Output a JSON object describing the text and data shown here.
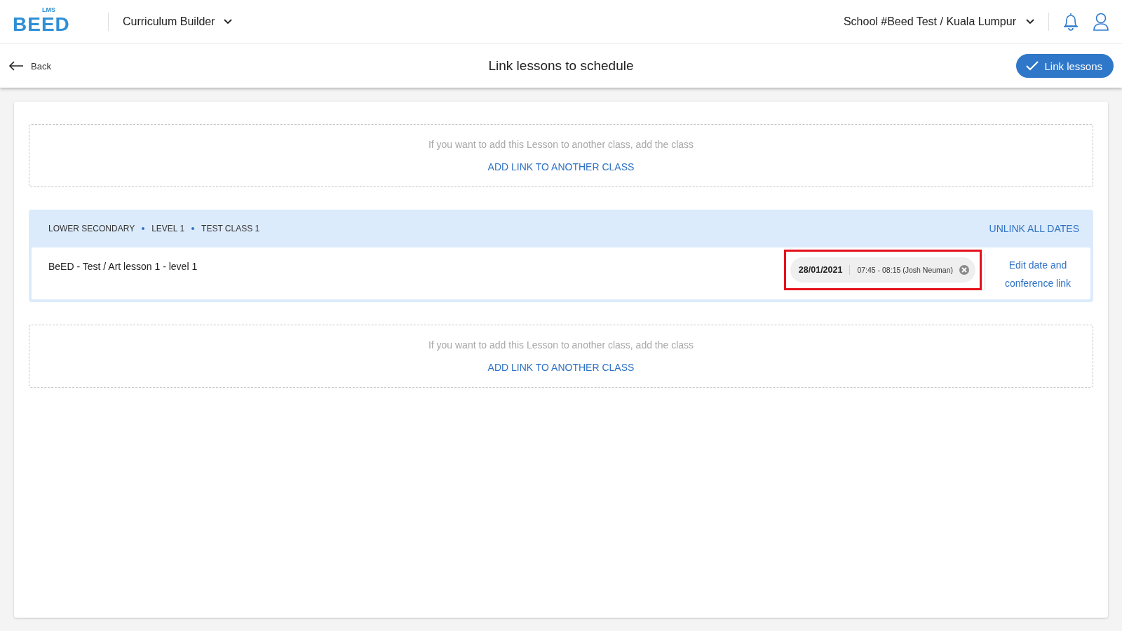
{
  "header": {
    "logo_text": "BEED",
    "logo_badge": "LMS",
    "module": "Curriculum Builder",
    "school": "School #Beed Test / Kuala Lumpur"
  },
  "toolbar": {
    "back": "Back",
    "title": "Link lessons to schedule",
    "action": "Link lessons"
  },
  "sections": [
    {
      "kind": "add_link",
      "hint": "If you want to add this Lesson to another class, add the class",
      "action": "ADD LINK TO ANOTHER CLASS"
    },
    {
      "kind": "class",
      "breadcrumb": [
        "LOWER SECONDARY",
        "LEVEL 1",
        "TEST CLASS 1"
      ],
      "action": "UNLINK ALL DATES",
      "lessons": [
        {
          "title": "BeED - Test / Art lesson 1 - level 1",
          "date": "28/01/2021",
          "time": "07:45 - 08:15 (Josh Neuman)",
          "highlighted": true,
          "edit": "Edit date and conference link"
        }
      ]
    },
    {
      "kind": "add_link",
      "hint": "If you want to add this Lesson to another class, add the class",
      "action": "ADD LINK TO ANOTHER CLASS"
    }
  ]
}
